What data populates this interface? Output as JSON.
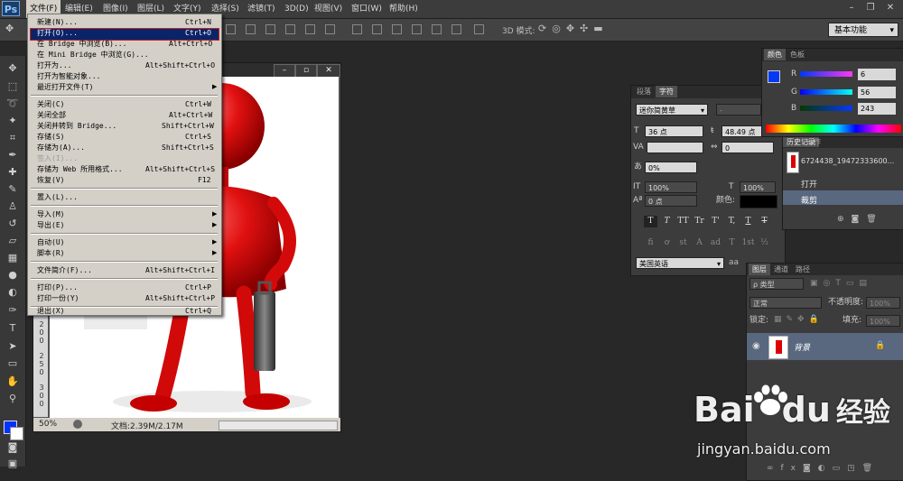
{
  "app": {
    "logo": "Ps"
  },
  "menubar": {
    "items": [
      "文件(F)",
      "编辑(E)",
      "图像(I)",
      "图层(L)",
      "文字(Y)",
      "选择(S)",
      "滤镜(T)",
      "3D(D)",
      "视图(V)",
      "窗口(W)",
      "帮助(H)"
    ],
    "active_index": 0
  },
  "options_bar": {
    "mode3d_label": "3D 模式:",
    "workspace": "基本功能"
  },
  "file_menu": {
    "items": [
      {
        "label": "新建(N)...",
        "shortcut": "Ctrl+N"
      },
      {
        "label": "打开(O)...",
        "shortcut": "Ctrl+O",
        "highlighted": true
      },
      {
        "label": "在 Bridge 中浏览(B)...",
        "shortcut": "Alt+Ctrl+O"
      },
      {
        "label": "在 Mini Bridge 中浏览(G)..."
      },
      {
        "label": "打开为...",
        "shortcut": "Alt+Shift+Ctrl+O"
      },
      {
        "label": "打开为智能对象..."
      },
      {
        "label": "最近打开文件(T)",
        "submenu": true
      },
      {
        "label": "关闭(C)",
        "shortcut": "Ctrl+W"
      },
      {
        "label": "关闭全部",
        "shortcut": "Alt+Ctrl+W"
      },
      {
        "label": "关闭并转到 Bridge...",
        "shortcut": "Shift+Ctrl+W"
      },
      {
        "label": "存储(S)",
        "shortcut": "Ctrl+S"
      },
      {
        "label": "存储为(A)...",
        "shortcut": "Shift+Ctrl+S"
      },
      {
        "label": "签入(I)...",
        "disabled": true
      },
      {
        "label": "存储为 Web 所用格式...",
        "shortcut": "Alt+Shift+Ctrl+S"
      },
      {
        "label": "恢复(V)",
        "shortcut": "F12"
      },
      {
        "label": "置入(L)..."
      },
      {
        "label": "导入(M)",
        "submenu": true
      },
      {
        "label": "导出(E)",
        "submenu": true
      },
      {
        "label": "自动(U)",
        "submenu": true
      },
      {
        "label": "脚本(R)",
        "submenu": true
      },
      {
        "label": "文件简介(F)...",
        "shortcut": "Alt+Shift+Ctrl+I"
      },
      {
        "label": "打印(P)...",
        "shortcut": "Ctrl+P"
      },
      {
        "label": "打印一份(Y)",
        "shortcut": "Alt+Shift+Ctrl+P"
      },
      {
        "label": "退出(X)",
        "shortcut": "Ctrl+Q"
      }
    ],
    "submenu_glyph": "▶"
  },
  "document": {
    "zoom": "50%",
    "info": "文档:2.39M/2.17M",
    "ruler_marks": [
      "1",
      "5",
      "0",
      "2",
      "0",
      "0",
      "2",
      "5",
      "0",
      "3",
      "0",
      "0",
      "3",
      "5",
      "0"
    ]
  },
  "character_panel": {
    "tabs": [
      "段落",
      "字符"
    ],
    "font_family": "迷你简黄草",
    "font_style": "-",
    "font_size": "36 点",
    "leading": "48.49 点",
    "kerning": "",
    "tracking": "0",
    "scale_tsume": "0%",
    "vertical_scale": "100%",
    "horizontal_scale": "100%",
    "baseline_shift": "0 点",
    "color_label": "颜色:",
    "style_buttons": [
      "T",
      "T",
      "TT",
      "Tr",
      "T'",
      "T,",
      "T",
      "T"
    ],
    "opentype_buttons": [
      "fi",
      "ơ",
      "st",
      "A",
      "ad",
      "T",
      "1st",
      "½"
    ],
    "language": "美国英语",
    "aa_label": "aa"
  },
  "color_panel": {
    "tabs": [
      "颜色",
      "色板"
    ],
    "r_label": "R",
    "g_label": "G",
    "b_label": "B",
    "r": "6",
    "g": "56",
    "b": "243",
    "fg_color": "#0638f3"
  },
  "history_panel": {
    "tabs": [
      "历史记录",
      "动作"
    ],
    "snapshot": "6724438_19472333600...",
    "items": [
      "打开",
      "裁剪"
    ]
  },
  "layers_panel": {
    "tabs": [
      "图层",
      "通道",
      "路径"
    ],
    "filter_kind": "ρ 类型",
    "blend_mode": "正常",
    "opacity_label": "不透明度:",
    "opacity": "100%",
    "lock_label": "锁定:",
    "fill_label": "填充:",
    "fill": "100%",
    "layer_name": "背景"
  },
  "watermark": {
    "logo_left": "Bai",
    "logo_right": "du",
    "suffix": "经验",
    "url": "jingyan.baidu.com"
  }
}
